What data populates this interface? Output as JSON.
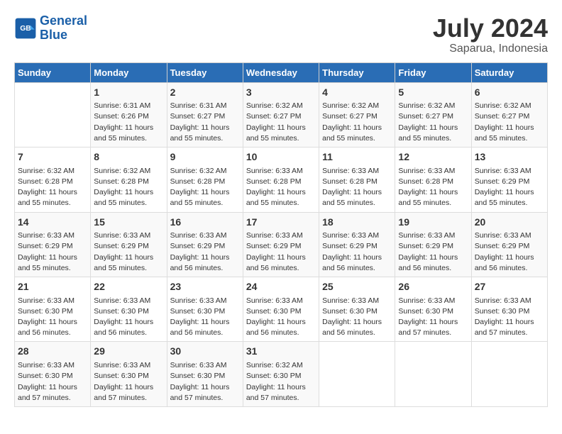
{
  "header": {
    "logo_line1": "General",
    "logo_line2": "Blue",
    "month": "July 2024",
    "location": "Saparua, Indonesia"
  },
  "weekdays": [
    "Sunday",
    "Monday",
    "Tuesday",
    "Wednesday",
    "Thursday",
    "Friday",
    "Saturday"
  ],
  "weeks": [
    [
      {
        "day": "",
        "info": ""
      },
      {
        "day": "1",
        "info": "Sunrise: 6:31 AM\nSunset: 6:26 PM\nDaylight: 11 hours\nand 55 minutes."
      },
      {
        "day": "2",
        "info": "Sunrise: 6:31 AM\nSunset: 6:27 PM\nDaylight: 11 hours\nand 55 minutes."
      },
      {
        "day": "3",
        "info": "Sunrise: 6:32 AM\nSunset: 6:27 PM\nDaylight: 11 hours\nand 55 minutes."
      },
      {
        "day": "4",
        "info": "Sunrise: 6:32 AM\nSunset: 6:27 PM\nDaylight: 11 hours\nand 55 minutes."
      },
      {
        "day": "5",
        "info": "Sunrise: 6:32 AM\nSunset: 6:27 PM\nDaylight: 11 hours\nand 55 minutes."
      },
      {
        "day": "6",
        "info": "Sunrise: 6:32 AM\nSunset: 6:27 PM\nDaylight: 11 hours\nand 55 minutes."
      }
    ],
    [
      {
        "day": "7",
        "info": "Sunrise: 6:32 AM\nSunset: 6:28 PM\nDaylight: 11 hours\nand 55 minutes."
      },
      {
        "day": "8",
        "info": "Sunrise: 6:32 AM\nSunset: 6:28 PM\nDaylight: 11 hours\nand 55 minutes."
      },
      {
        "day": "9",
        "info": "Sunrise: 6:32 AM\nSunset: 6:28 PM\nDaylight: 11 hours\nand 55 minutes."
      },
      {
        "day": "10",
        "info": "Sunrise: 6:33 AM\nSunset: 6:28 PM\nDaylight: 11 hours\nand 55 minutes."
      },
      {
        "day": "11",
        "info": "Sunrise: 6:33 AM\nSunset: 6:28 PM\nDaylight: 11 hours\nand 55 minutes."
      },
      {
        "day": "12",
        "info": "Sunrise: 6:33 AM\nSunset: 6:28 PM\nDaylight: 11 hours\nand 55 minutes."
      },
      {
        "day": "13",
        "info": "Sunrise: 6:33 AM\nSunset: 6:29 PM\nDaylight: 11 hours\nand 55 minutes."
      }
    ],
    [
      {
        "day": "14",
        "info": "Sunrise: 6:33 AM\nSunset: 6:29 PM\nDaylight: 11 hours\nand 55 minutes."
      },
      {
        "day": "15",
        "info": "Sunrise: 6:33 AM\nSunset: 6:29 PM\nDaylight: 11 hours\nand 55 minutes."
      },
      {
        "day": "16",
        "info": "Sunrise: 6:33 AM\nSunset: 6:29 PM\nDaylight: 11 hours\nand 56 minutes."
      },
      {
        "day": "17",
        "info": "Sunrise: 6:33 AM\nSunset: 6:29 PM\nDaylight: 11 hours\nand 56 minutes."
      },
      {
        "day": "18",
        "info": "Sunrise: 6:33 AM\nSunset: 6:29 PM\nDaylight: 11 hours\nand 56 minutes."
      },
      {
        "day": "19",
        "info": "Sunrise: 6:33 AM\nSunset: 6:29 PM\nDaylight: 11 hours\nand 56 minutes."
      },
      {
        "day": "20",
        "info": "Sunrise: 6:33 AM\nSunset: 6:29 PM\nDaylight: 11 hours\nand 56 minutes."
      }
    ],
    [
      {
        "day": "21",
        "info": "Sunrise: 6:33 AM\nSunset: 6:30 PM\nDaylight: 11 hours\nand 56 minutes."
      },
      {
        "day": "22",
        "info": "Sunrise: 6:33 AM\nSunset: 6:30 PM\nDaylight: 11 hours\nand 56 minutes."
      },
      {
        "day": "23",
        "info": "Sunrise: 6:33 AM\nSunset: 6:30 PM\nDaylight: 11 hours\nand 56 minutes."
      },
      {
        "day": "24",
        "info": "Sunrise: 6:33 AM\nSunset: 6:30 PM\nDaylight: 11 hours\nand 56 minutes."
      },
      {
        "day": "25",
        "info": "Sunrise: 6:33 AM\nSunset: 6:30 PM\nDaylight: 11 hours\nand 56 minutes."
      },
      {
        "day": "26",
        "info": "Sunrise: 6:33 AM\nSunset: 6:30 PM\nDaylight: 11 hours\nand 57 minutes."
      },
      {
        "day": "27",
        "info": "Sunrise: 6:33 AM\nSunset: 6:30 PM\nDaylight: 11 hours\nand 57 minutes."
      }
    ],
    [
      {
        "day": "28",
        "info": "Sunrise: 6:33 AM\nSunset: 6:30 PM\nDaylight: 11 hours\nand 57 minutes."
      },
      {
        "day": "29",
        "info": "Sunrise: 6:33 AM\nSunset: 6:30 PM\nDaylight: 11 hours\nand 57 minutes."
      },
      {
        "day": "30",
        "info": "Sunrise: 6:33 AM\nSunset: 6:30 PM\nDaylight: 11 hours\nand 57 minutes."
      },
      {
        "day": "31",
        "info": "Sunrise: 6:32 AM\nSunset: 6:30 PM\nDaylight: 11 hours\nand 57 minutes."
      },
      {
        "day": "",
        "info": ""
      },
      {
        "day": "",
        "info": ""
      },
      {
        "day": "",
        "info": ""
      }
    ]
  ]
}
